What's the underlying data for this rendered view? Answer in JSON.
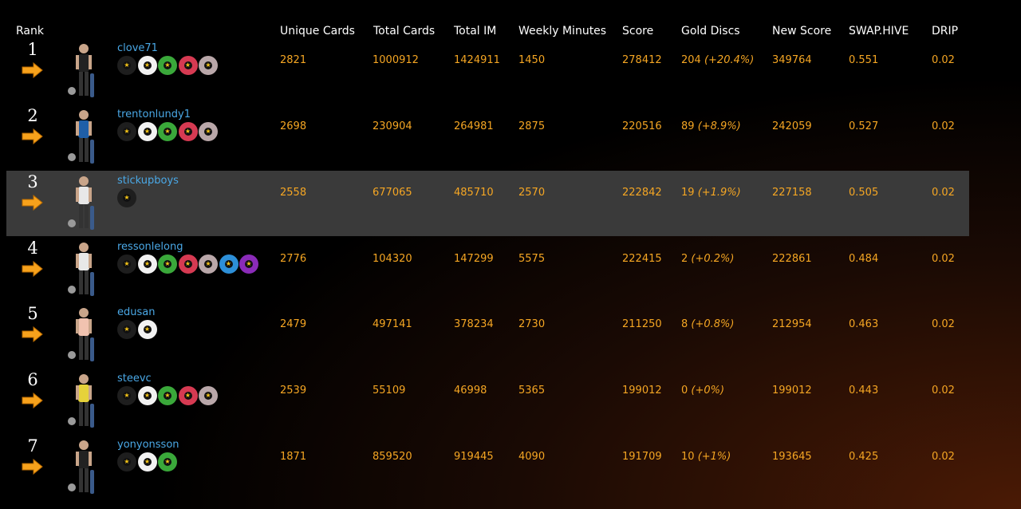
{
  "headers": {
    "rank": "Rank",
    "unique_cards": "Unique Cards",
    "total_cards": "Total Cards",
    "total_im": "Total IM",
    "weekly_minutes": "Weekly Minutes",
    "score": "Score",
    "gold_discs": "Gold Discs",
    "new_score": "New Score",
    "swaphive": "SWAP.HIVE",
    "drip": "DRIP"
  },
  "disc_colors": {
    "black": "#1e1e1e",
    "white": "#f2f2f2",
    "green": "#3aa83a",
    "red": "#d63a52",
    "silver": "#b9a7a9",
    "blue": "#2d8fd8",
    "purple": "#8a2bb8"
  },
  "rows": [
    {
      "rank": "1",
      "username": "clove71",
      "discs": [
        "black",
        "white",
        "green",
        "red",
        "silver"
      ],
      "unique_cards": "2821",
      "total_cards": "1000912",
      "total_im": "1424911",
      "weekly_minutes": "1450",
      "score": "278412",
      "gold_count": "204",
      "gold_pct": "(+20.4%)",
      "new_score": "349764",
      "swaphive": "0.551",
      "drip": "0.02",
      "highlight": false
    },
    {
      "rank": "2",
      "username": "trentonlundy1",
      "discs": [
        "black",
        "white",
        "green",
        "red",
        "silver"
      ],
      "unique_cards": "2698",
      "total_cards": "230904",
      "total_im": "264981",
      "weekly_minutes": "2875",
      "score": "220516",
      "gold_count": "89",
      "gold_pct": "(+8.9%)",
      "new_score": "242059",
      "swaphive": "0.527",
      "drip": "0.02",
      "highlight": false
    },
    {
      "rank": "3",
      "username": "stickupboys",
      "discs": [
        "black"
      ],
      "unique_cards": "2558",
      "total_cards": "677065",
      "total_im": "485710",
      "weekly_minutes": "2570",
      "score": "222842",
      "gold_count": "19",
      "gold_pct": "(+1.9%)",
      "new_score": "227158",
      "swaphive": "0.505",
      "drip": "0.02",
      "highlight": true
    },
    {
      "rank": "4",
      "username": "ressonlelong",
      "discs": [
        "black",
        "white",
        "green",
        "red",
        "silver",
        "blue",
        "purple"
      ],
      "unique_cards": "2776",
      "total_cards": "104320",
      "total_im": "147299",
      "weekly_minutes": "5575",
      "score": "222415",
      "gold_count": "2",
      "gold_pct": "(+0.2%)",
      "new_score": "222861",
      "swaphive": "0.484",
      "drip": "0.02",
      "highlight": false
    },
    {
      "rank": "5",
      "username": "edusan",
      "discs": [
        "black",
        "white"
      ],
      "unique_cards": "2479",
      "total_cards": "497141",
      "total_im": "378234",
      "weekly_minutes": "2730",
      "score": "211250",
      "gold_count": "8",
      "gold_pct": "(+0.8%)",
      "new_score": "212954",
      "swaphive": "0.463",
      "drip": "0.02",
      "highlight": false
    },
    {
      "rank": "6",
      "username": "steevc",
      "discs": [
        "black",
        "white",
        "green",
        "red",
        "silver"
      ],
      "unique_cards": "2539",
      "total_cards": "55109",
      "total_im": "46998",
      "weekly_minutes": "5365",
      "score": "199012",
      "gold_count": "0",
      "gold_pct": "(+0%)",
      "new_score": "199012",
      "swaphive": "0.443",
      "drip": "0.02",
      "highlight": false
    },
    {
      "rank": "7",
      "username": "yonyonsson",
      "discs": [
        "black",
        "white",
        "green"
      ],
      "unique_cards": "1871",
      "total_cards": "859520",
      "total_im": "919445",
      "weekly_minutes": "4090",
      "score": "191709",
      "gold_count": "10",
      "gold_pct": "(+1%)",
      "new_score": "193645",
      "swaphive": "0.425",
      "drip": "0.02",
      "highlight": false
    }
  ]
}
